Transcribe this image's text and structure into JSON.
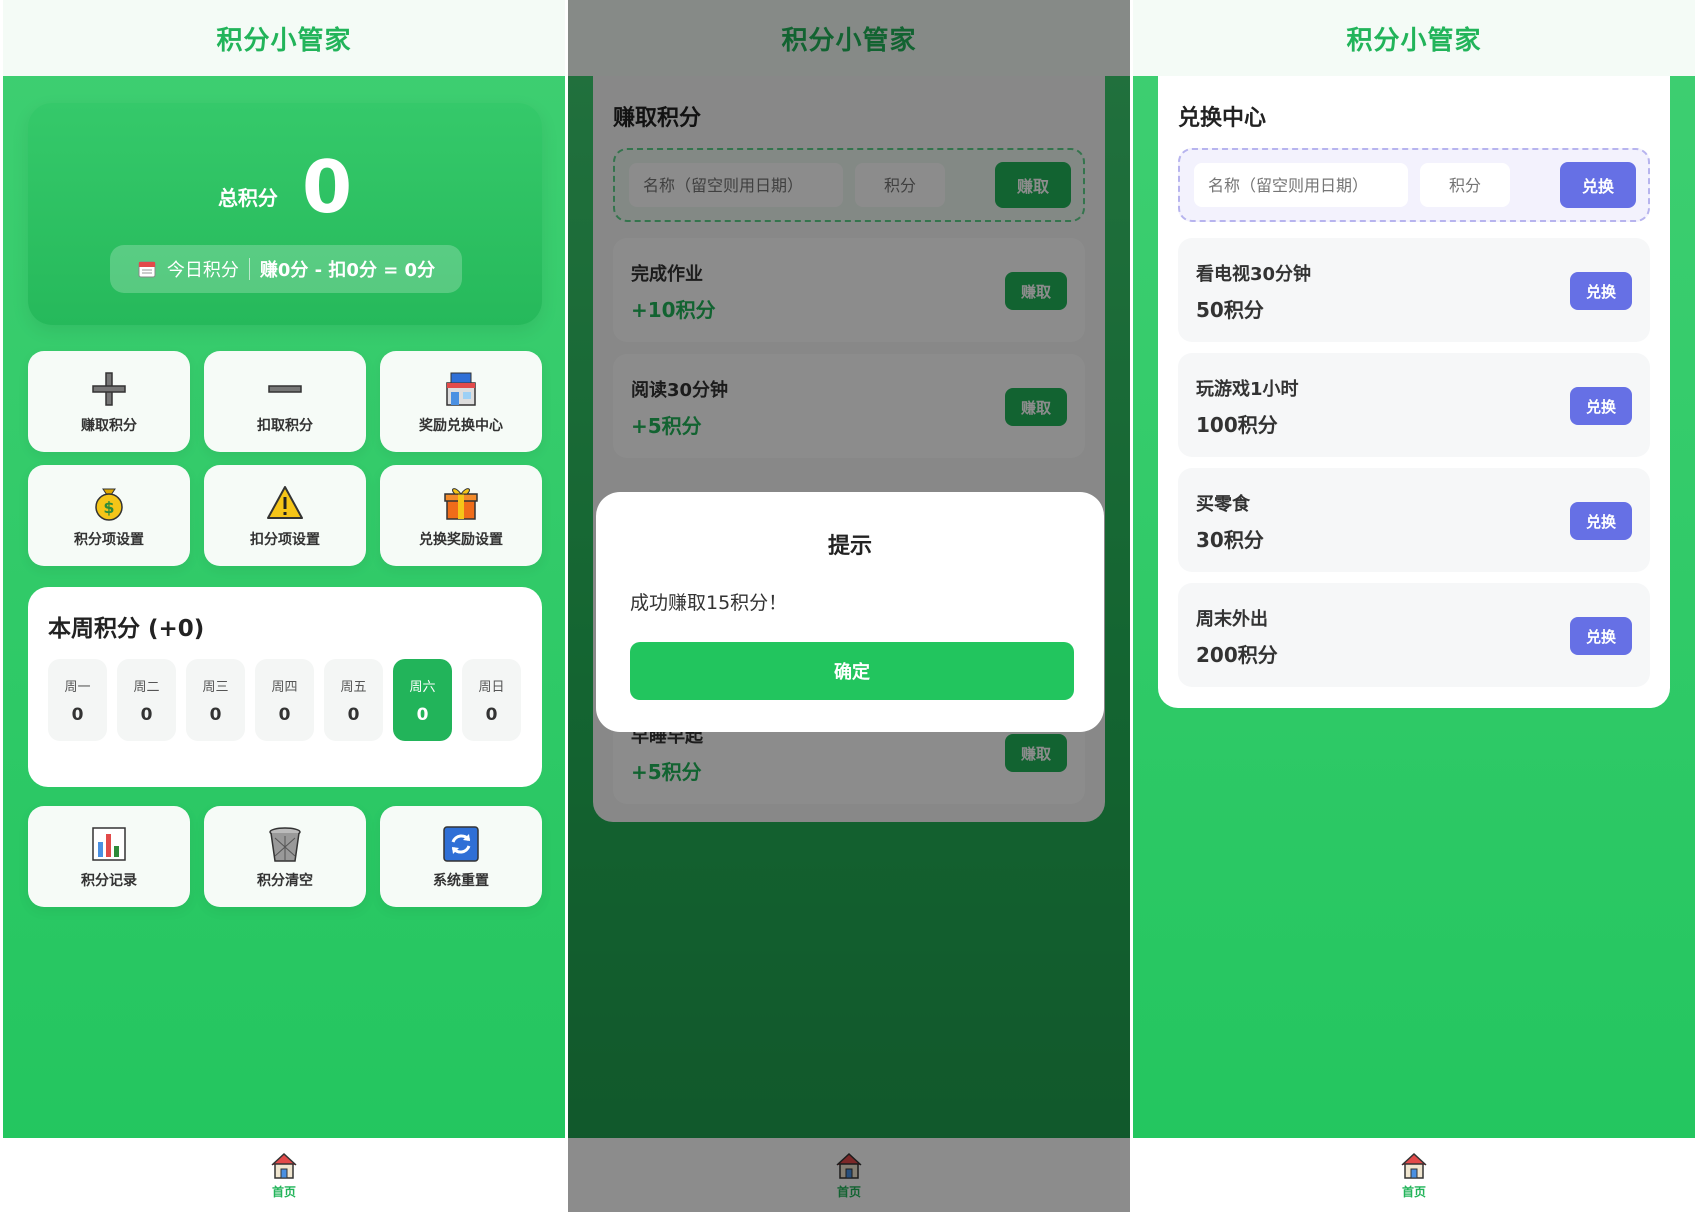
{
  "app": {
    "title": "积分小管家"
  },
  "tabbar": {
    "home_label": "首页"
  },
  "home": {
    "total_label": "总积分",
    "total_value": "0",
    "today_label": "今日积分",
    "today_formula": "赚0分 - 扣0分 = 0分",
    "actions": [
      {
        "label": "赚取积分",
        "icon": "plus-icon"
      },
      {
        "label": "扣取积分",
        "icon": "minus-icon"
      },
      {
        "label": "奖励兑换中心",
        "icon": "store-icon"
      },
      {
        "label": "积分项设置",
        "icon": "money-bag-icon"
      },
      {
        "label": "扣分项设置",
        "icon": "warning-icon"
      },
      {
        "label": "兑换奖励设置",
        "icon": "gift-icon"
      }
    ],
    "week": {
      "title": "本周积分 (+0)",
      "days": [
        {
          "name": "周一",
          "value": "0"
        },
        {
          "name": "周二",
          "value": "0"
        },
        {
          "name": "周三",
          "value": "0"
        },
        {
          "name": "周四",
          "value": "0"
        },
        {
          "name": "周五",
          "value": "0"
        },
        {
          "name": "周六",
          "value": "0"
        },
        {
          "name": "周日",
          "value": "0"
        }
      ],
      "active_day": "周六"
    },
    "tools": [
      {
        "label": "积分记录",
        "icon": "bar-chart-icon"
      },
      {
        "label": "积分清空",
        "icon": "trash-icon"
      },
      {
        "label": "系统重置",
        "icon": "refresh-icon"
      }
    ]
  },
  "earn": {
    "title": "赚取积分",
    "name_placeholder": "名称（留空则用日期）",
    "points_placeholder": "积分",
    "submit_label": "赚取",
    "tasks": [
      {
        "name": "完成作业",
        "points": "+10积分",
        "button": "赚取"
      },
      {
        "name": "阅读30分钟",
        "points": "+5积分",
        "button": "赚取"
      },
      {
        "name": "早睡早起",
        "points": "+5积分",
        "button": "赚取"
      }
    ]
  },
  "dialog": {
    "title": "提示",
    "message": "成功赚取15积分！",
    "ok_label": "确定"
  },
  "exchange": {
    "title": "兑换中心",
    "name_placeholder": "名称（留空则用日期）",
    "points_placeholder": "积分",
    "submit_label": "兑换",
    "rewards": [
      {
        "name": "看电视30分钟",
        "cost": "50积分",
        "button": "兑换"
      },
      {
        "name": "玩游戏1小时",
        "cost": "100积分",
        "button": "兑换"
      },
      {
        "name": "买零食",
        "cost": "30积分",
        "button": "兑换"
      },
      {
        "name": "周末外出",
        "cost": "200积分",
        "button": "兑换"
      }
    ]
  },
  "colors": {
    "brand_green": "#22b45a",
    "bg_green": "#3fcf72",
    "exchange_purple": "#6670e5"
  }
}
